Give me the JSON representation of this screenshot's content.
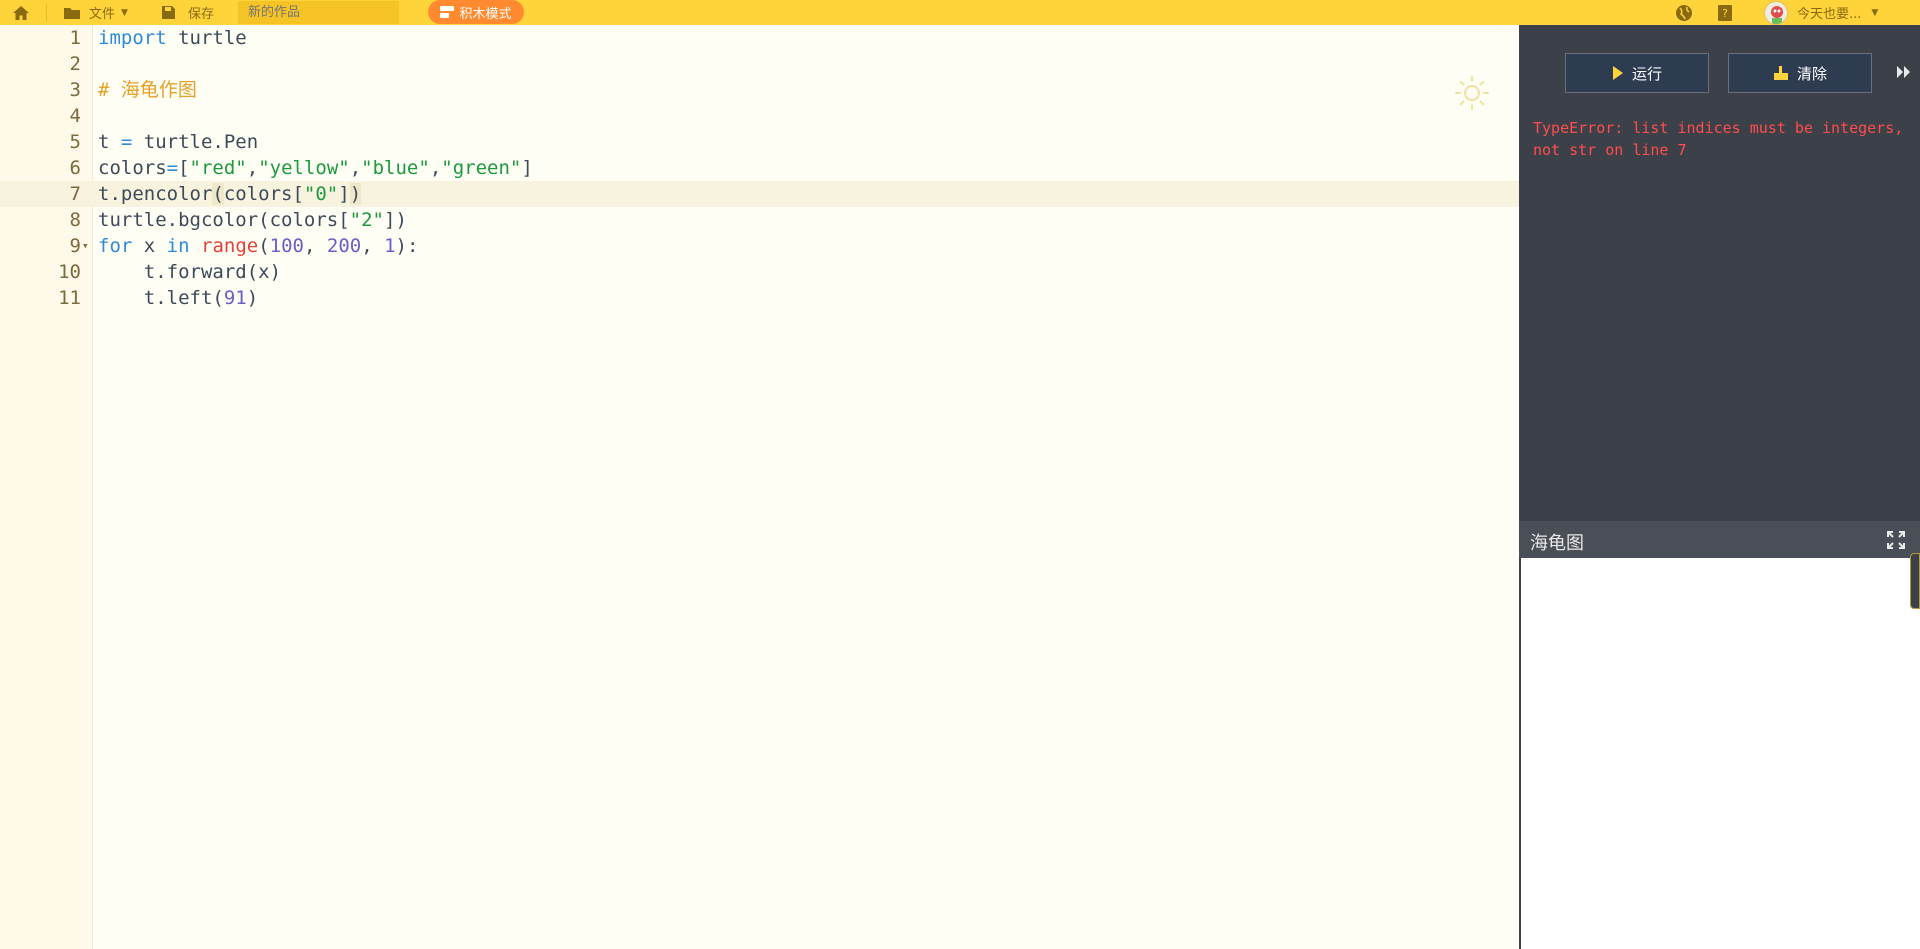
{
  "topbar": {
    "home_icon": "home-icon",
    "file_menu": "文件",
    "save_label": "保存",
    "title_placeholder": "新的作品",
    "block_mode_label": "积木模式",
    "username": "今天也要..."
  },
  "editor": {
    "lines": [
      {
        "num": "1"
      },
      {
        "num": "2"
      },
      {
        "num": "3"
      },
      {
        "num": "4"
      },
      {
        "num": "5"
      },
      {
        "num": "6"
      },
      {
        "num": "7"
      },
      {
        "num": "8"
      },
      {
        "num": "9"
      },
      {
        "num": "10"
      },
      {
        "num": "11"
      }
    ],
    "code": {
      "l1_kw": "import",
      "l1_rest": " turtle",
      "l3_comment": "# 海龟作图",
      "l5_a": "t ",
      "l5_op": "=",
      "l5_b": " turtle.Pen",
      "l6_a": "colors",
      "l6_op": "=",
      "l6_b": "[",
      "l6_s1": "\"red\"",
      "l6_c1": ",",
      "l6_s2": "\"yellow\"",
      "l6_c2": ",",
      "l6_s3": "\"blue\"",
      "l6_c3": ",",
      "l6_s4": "\"green\"",
      "l6_end": "]",
      "l7_a": "t.pencolor",
      "l7_b": "(",
      "l7_c": "colors[",
      "l7_s": "\"0\"",
      "l7_d": "]",
      "l7_e": ")",
      "l8_a": "turtle.bgcolor(colors[",
      "l8_s": "\"2\"",
      "l8_b": "])",
      "l9_kw1": "for",
      "l9_a": " x ",
      "l9_kw2": "in",
      "l9_sp": " ",
      "l9_bi": "range",
      "l9_p": "(",
      "l9_n1": "100",
      "l9_c1": ", ",
      "l9_n2": "200",
      "l9_c2": ", ",
      "l9_n3": "1",
      "l9_end": "):",
      "l10": "    t.forward(x)",
      "l11_a": "    t.left(",
      "l11_n": "91",
      "l11_b": ")"
    }
  },
  "panel": {
    "run_label": "运行",
    "clear_label": "清除",
    "error_text": "TypeError: list indices must be integers, not str on line 7",
    "canvas_title": "海龟图"
  },
  "colors": {
    "topbar": "#ffd43a",
    "block_mode": "#ff8a2f",
    "panel_bg": "#3c4049",
    "error": "#ff4d4d"
  }
}
